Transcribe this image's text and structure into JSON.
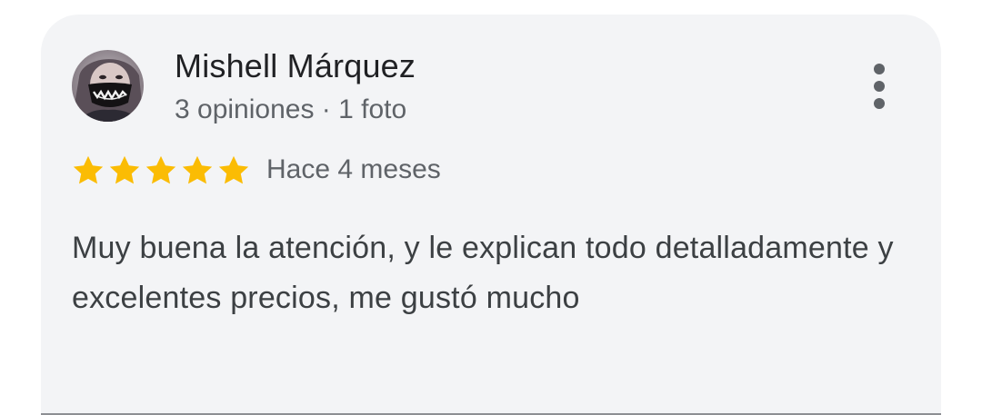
{
  "review": {
    "author_name": "Mishell Márquez",
    "author_meta": "3 opiniones · 1 foto",
    "rating": 5,
    "rating_max": 5,
    "time_ago": "Hace 4 meses",
    "text": "Muy buena la atención, y le explican todo detalladamente y excelentes precios, me gustó mucho",
    "avatar_icon": "avatar-photo-masked-person",
    "menu_icon": "more-vert-icon",
    "star_icon": "star-icon"
  },
  "colors": {
    "card_background": "#f3f4f6",
    "star": "#fbbc04",
    "primary_text": "#202124",
    "secondary_text": "#5f6368",
    "body_text": "#3c4043"
  }
}
